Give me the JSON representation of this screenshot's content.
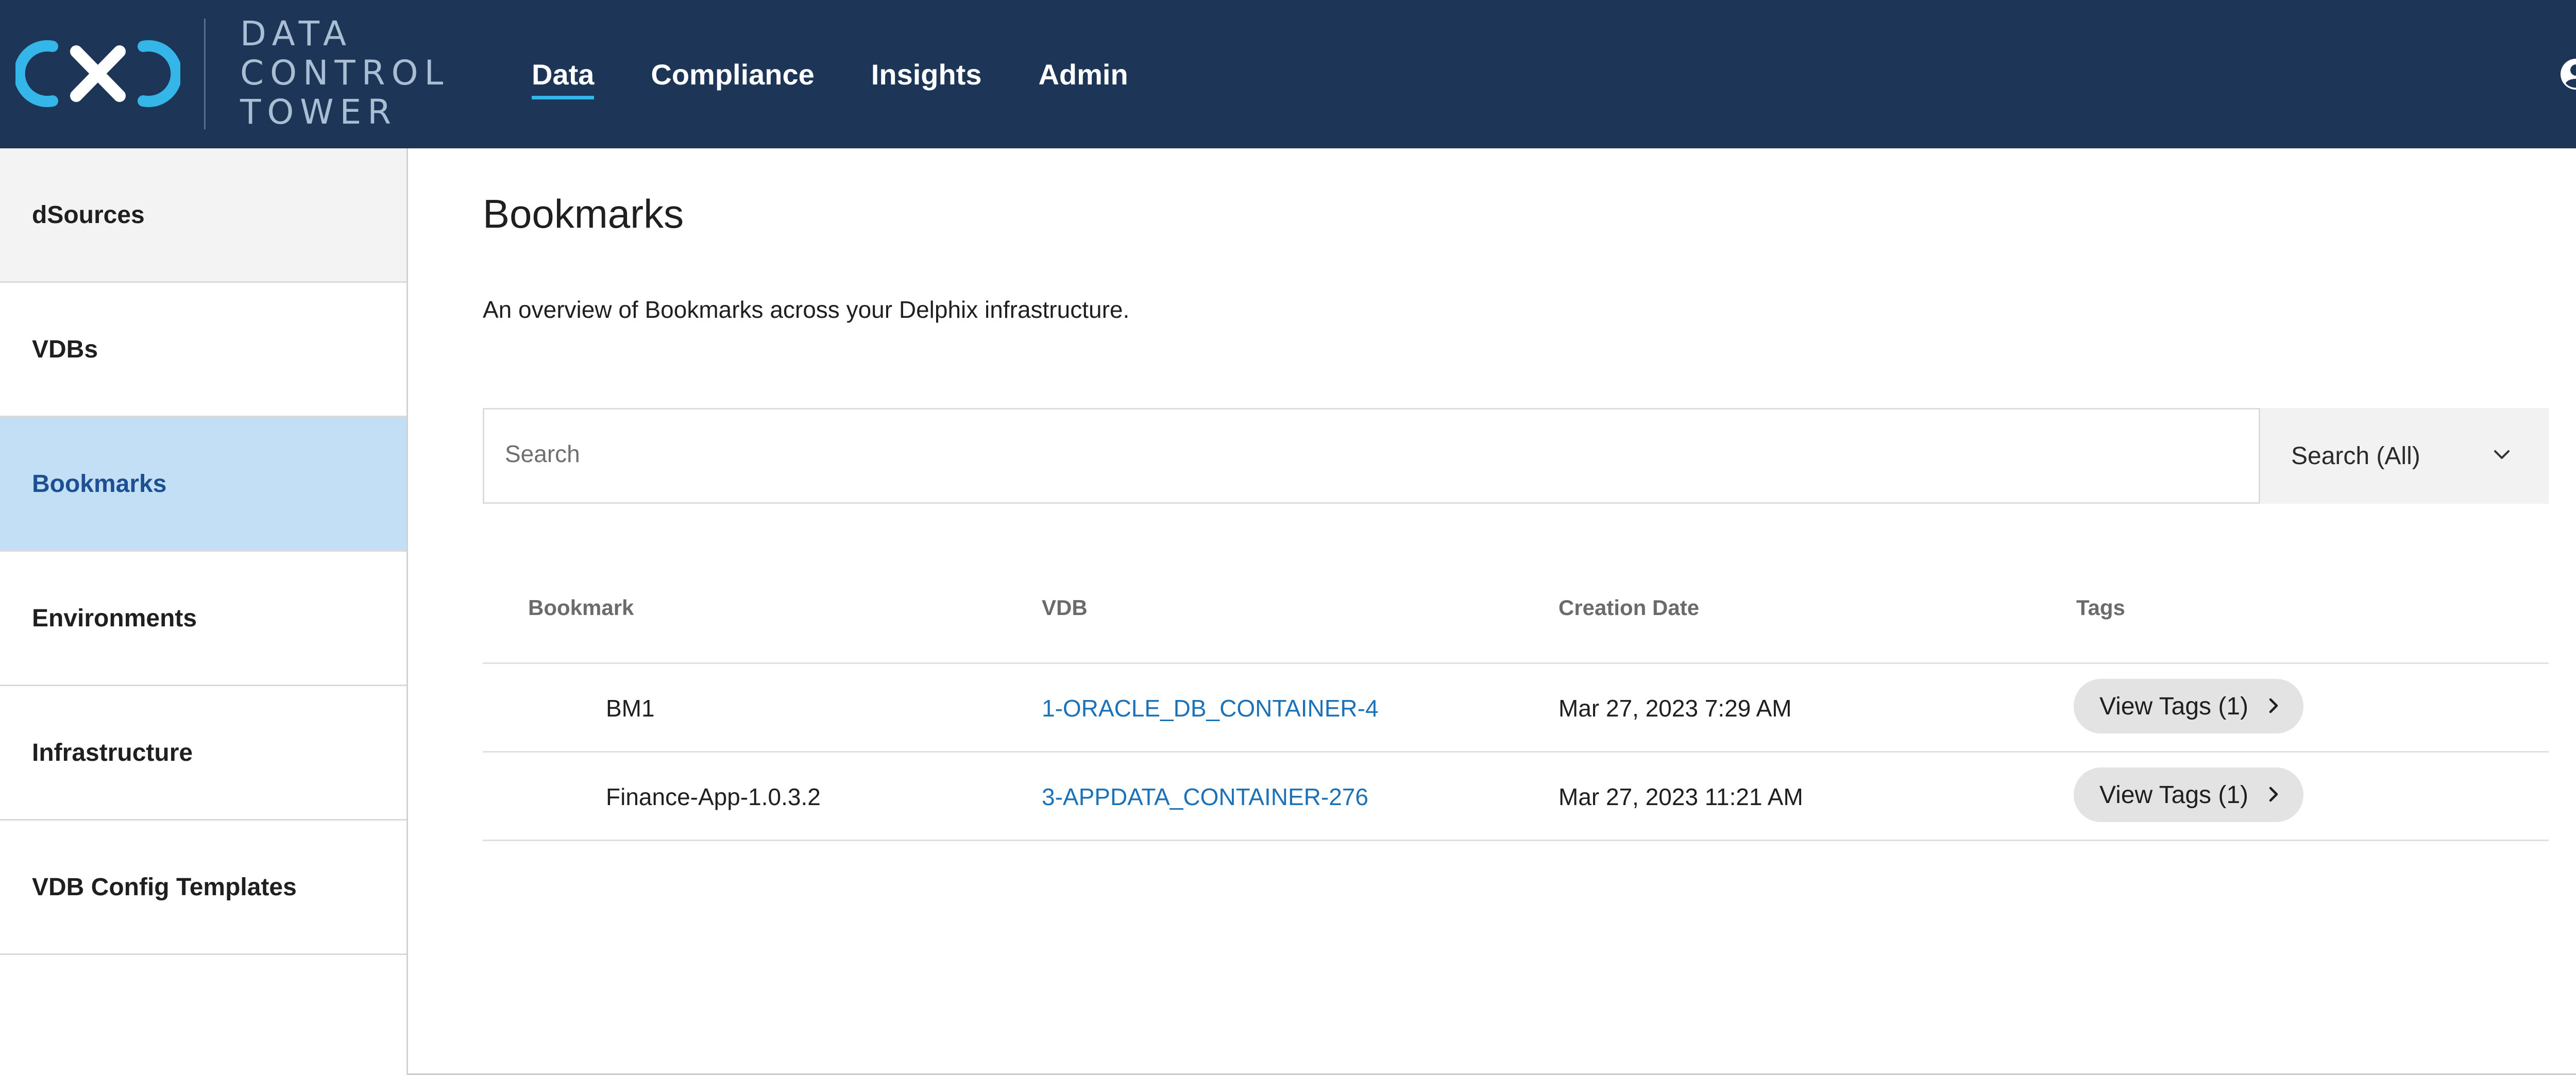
{
  "app": {
    "logo_lines": [
      "DATA",
      "CONTROL",
      "TOWER"
    ]
  },
  "nav": {
    "items": [
      {
        "label": "Data",
        "active": true
      },
      {
        "label": "Compliance",
        "active": false
      },
      {
        "label": "Insights",
        "active": false
      },
      {
        "label": "Admin",
        "active": false
      }
    ]
  },
  "sidebar": {
    "items": [
      {
        "label": "dSources"
      },
      {
        "label": "VDBs"
      },
      {
        "label": "Bookmarks",
        "active": true
      },
      {
        "label": "Environments"
      },
      {
        "label": "Infrastructure"
      },
      {
        "label": "VDB Config Templates"
      }
    ]
  },
  "main": {
    "title": "Bookmarks",
    "description": "An overview of Bookmarks across your Delphix infrastructure.",
    "search": {
      "placeholder": "Search",
      "value": "",
      "scope_selected": "Search (All)"
    },
    "table": {
      "columns": [
        "Bookmark",
        "VDB",
        "Creation Date",
        "Tags"
      ],
      "rows": [
        {
          "bookmark": "BM1",
          "vdb": "1-ORACLE_DB_CONTAINER-4",
          "created": "Mar 27, 2023 7:29 AM",
          "tags": "View Tags (1)"
        },
        {
          "bookmark": "Finance-App-1.0.3.2",
          "vdb": "3-APPDATA_CONTAINER-276",
          "created": "Mar 27, 2023 11:21 AM",
          "tags": "View Tags (1)"
        }
      ]
    }
  },
  "colors": {
    "header_bg": "#1d3657",
    "accent": "#35b6e8",
    "sidebar_active_bg": "#c2dff5",
    "link": "#1b72b9"
  },
  "icons": {
    "logo": "delphix-logo-icon",
    "user": "user-account-icon",
    "dropdown": "chevron-down-icon",
    "tag_arrow": "chevron-right-icon"
  }
}
